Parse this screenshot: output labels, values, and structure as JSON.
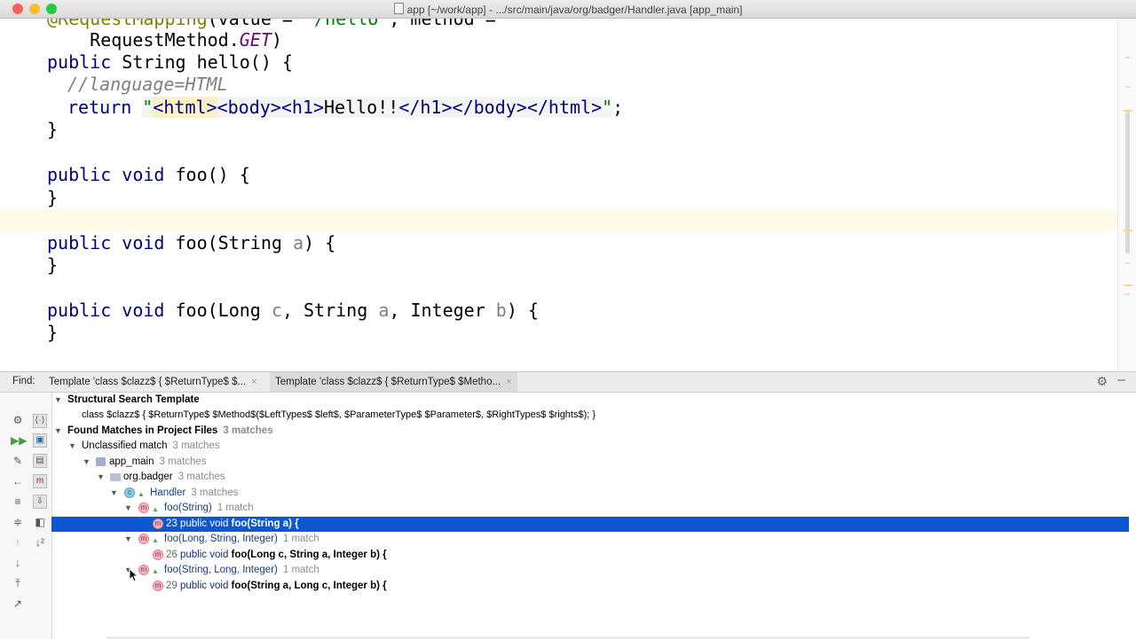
{
  "window": {
    "title": "app [~/work/app] - .../src/main/java/org/badger/Handler.java [app_main]",
    "traffic_colors": {
      "close": "#fc5f57",
      "minimize": "#fdbc2e",
      "maximize": "#28c840"
    }
  },
  "editor": {
    "line1": {
      "ann": "@RequestMapping",
      "rest": "(value = ",
      "str": "\"/hello\"",
      "mid": ", method ="
    },
    "line2": {
      "indent": "    RequestMethod.",
      "italic": "GET",
      "close": ")"
    },
    "line3": {
      "kw1": "public",
      "type": " String ",
      "name": "hello() {"
    },
    "line4": {
      "comment": "//language=HTML"
    },
    "line5": {
      "kw": "return",
      "q1": "\"",
      "t_html": "<html>",
      "t_body": "<body>",
      "t_h1": "<h1>",
      "text": "Hello!!",
      "t_h1c": "</h1>",
      "t_bodyc": "</body>",
      "t_htmlc": "</html>",
      "q2": "\"",
      "semi": ";"
    },
    "line6": "}",
    "line7": {
      "kw1": "public",
      "kw2": "void",
      "sig": "foo() {"
    },
    "line8": "}",
    "line9": {
      "kw1": "public",
      "kw2": "void",
      "name": "foo(String ",
      "param": "a",
      "close": ") {"
    },
    "line10": "}",
    "line11": {
      "kw1": "public",
      "kw2": "void",
      "p1": "foo(Long ",
      "a1": "c",
      "p2": ", String ",
      "a2": "a",
      "p3": ", Integer ",
      "a3": "b",
      "p4": ") {"
    },
    "line12": "}"
  },
  "find": {
    "label": "Find:",
    "tabs": [
      {
        "label": "Template 'class $clazz$ {   $ReturnType$ $..."
      },
      {
        "label": "Template 'class $clazz$ {   $ReturnType$ $Metho..."
      }
    ],
    "close_glyph": "×"
  },
  "tree": {
    "template_header": "Structural Search Template",
    "template_body": "class $clazz$ {   $ReturnType$ $Method$($LeftTypes$ $left$, $ParameterType$ $Parameter$, $RightTypes$ $rights$); }",
    "found_header": "Found Matches in Project Files",
    "found_count": "3 matches",
    "unclassified": {
      "label": "Unclassified match",
      "count": "3 matches"
    },
    "module": {
      "label": "app_main",
      "count": "3 matches"
    },
    "package": {
      "label": "org.badger",
      "count": "3 matches"
    },
    "class": {
      "label": "Handler",
      "count": "3 matches"
    },
    "groups": [
      {
        "label": "foo(String)",
        "count": "1 match",
        "line": "23",
        "prefix": "public void",
        "sig": "foo(String a) {"
      },
      {
        "label": "foo(Long, String, Integer)",
        "count": "1 match",
        "line": "26",
        "prefix": "public void",
        "sig": "foo(Long c, String a, Integer b) {"
      },
      {
        "label": "foo(String, Long, Integer)",
        "count": "1 match",
        "line": "29",
        "prefix": "public void",
        "sig": "foo(String a, Long c, Integer b) {"
      }
    ]
  }
}
